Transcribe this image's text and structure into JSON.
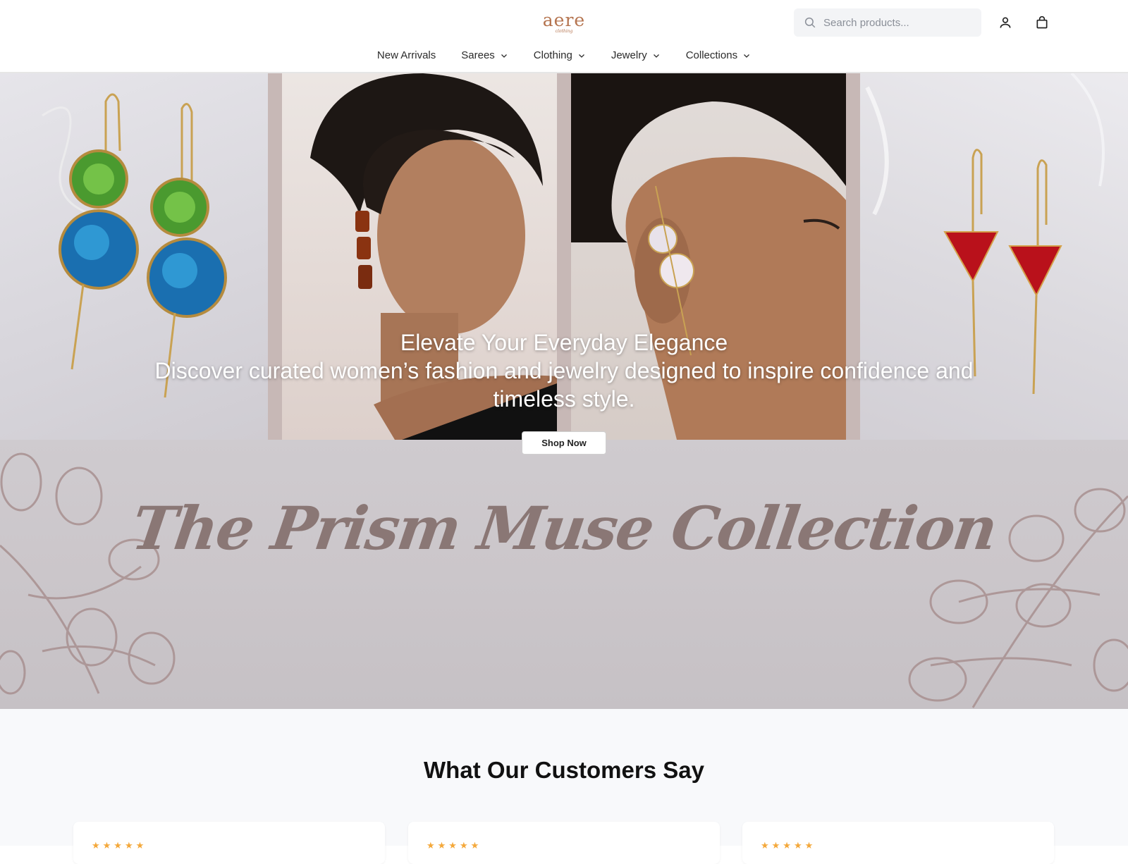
{
  "brand": {
    "logo_text": "aere",
    "logo_sub": "clothing",
    "accent_color": "#b5744f"
  },
  "search": {
    "placeholder": "Search products..."
  },
  "header_icons": [
    "user-icon",
    "shopping-bag-icon"
  ],
  "nav": {
    "items": [
      {
        "label": "New Arrivals",
        "has_dropdown": false
      },
      {
        "label": "Sarees",
        "has_dropdown": true
      },
      {
        "label": "Clothing",
        "has_dropdown": true
      },
      {
        "label": "Jewelry",
        "has_dropdown": true
      },
      {
        "label": "Collections",
        "has_dropdown": true
      }
    ]
  },
  "hero": {
    "title": "Elevate Your Everyday Elegance",
    "subtitle": "Discover curated women’s fashion and jewelry designed to inspire confidence and timeless style.",
    "cta_label": "Shop Now"
  },
  "collection": {
    "title": "The Prism Muse Collection",
    "title_color": "#8a7775"
  },
  "testimonials": {
    "heading": "What Our Customers Say",
    "star_color": "#f4a83a",
    "cards": [
      {
        "stars": "★★★★★"
      },
      {
        "stars": "★★★★★"
      },
      {
        "stars": "★★★★★"
      }
    ]
  }
}
